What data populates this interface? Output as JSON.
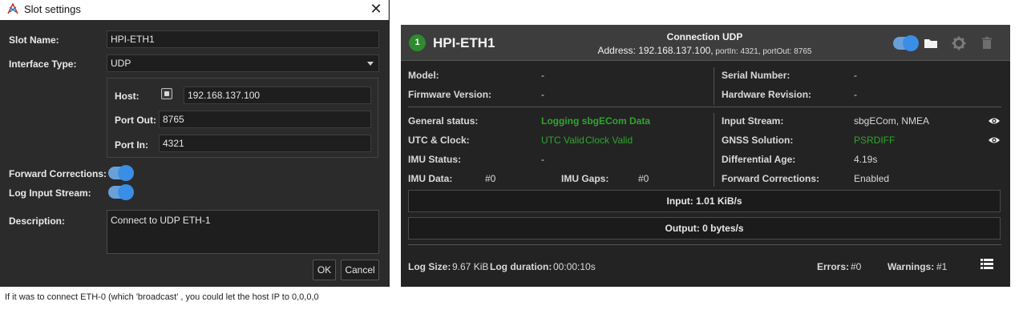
{
  "dialog": {
    "title": "Slot settings",
    "close_glyph": "✕",
    "slot_name_label": "Slot Name:",
    "slot_name_value": "HPI-ETH1",
    "interface_type_label": "Interface Type:",
    "interface_type_value": "UDP",
    "host_label": "Host:",
    "host_value": "192.168.137.100",
    "port_out_label": "Port Out:",
    "port_out_value": "8765",
    "port_in_label": "Port In:",
    "port_in_value": "4321",
    "forward_corrections_label": "Forward Corrections:",
    "forward_corrections_on": true,
    "log_input_stream_label": "Log Input Stream:",
    "log_input_stream_on": true,
    "description_label": "Description:",
    "description_value": "Connect to UDP ETH-1",
    "ok_label": "OK",
    "cancel_label": "Cancel"
  },
  "note": "If it was to connect ETH-0 (which 'broadcast' , you could let the host IP to 0,0,0,0",
  "panel": {
    "slot_number": "1",
    "slot_name": "HPI-ETH1",
    "connection_title": "Connection UDP",
    "address_prefix": "Address: ",
    "address_value": "192.168.137.100,",
    "ports_text": " portIn: 4321, portOut: 8765",
    "enabled": true,
    "icons": [
      "toggle-icon",
      "folder-icon",
      "gear-icon",
      "trash-icon"
    ],
    "model_label": "Model:",
    "model_value": "-",
    "firmware_label": "Firmware Version:",
    "firmware_value": "-",
    "serial_label": "Serial Number:",
    "serial_value": "-",
    "hardware_label": "Hardware Revision:",
    "hardware_value": "-",
    "general_status_label": "General status:",
    "general_status_value": "Logging sbgECom Data",
    "utc_label": "UTC & Clock:",
    "utc_value": "UTC Valid",
    "clock_value": "Clock Valid",
    "imu_status_label": "IMU Status:",
    "imu_status_value": "-",
    "imu_data_label": "IMU Data:",
    "imu_data_value": "#0",
    "imu_gaps_label": "IMU Gaps:",
    "imu_gaps_value": "#0",
    "input_stream_label": "Input Stream:",
    "input_stream_value": "sbgECom, NMEA",
    "gnss_label": "GNSS Solution:",
    "gnss_value": "PSRDIFF",
    "diff_age_label": "Differential Age:",
    "diff_age_value": "4.19s",
    "fwd_corr_label": "Forward Corrections:",
    "fwd_corr_value": "Enabled",
    "input_rate": "Input: 1.01 KiB/s",
    "output_rate": "Output: 0 bytes/s",
    "log_size_label": "Log Size:",
    "log_size_value": "9.67 KiB",
    "log_duration_label": "Log duration:",
    "log_duration_value": "00:00:10s",
    "errors_label": "Errors:",
    "errors_value": "#0",
    "warnings_label": "Warnings:",
    "warnings_value": "#1"
  },
  "colors": {
    "ok_green": "#2fa52f",
    "toggle_blue": "#3a8ee6",
    "badge_green": "#2e8a2e"
  }
}
